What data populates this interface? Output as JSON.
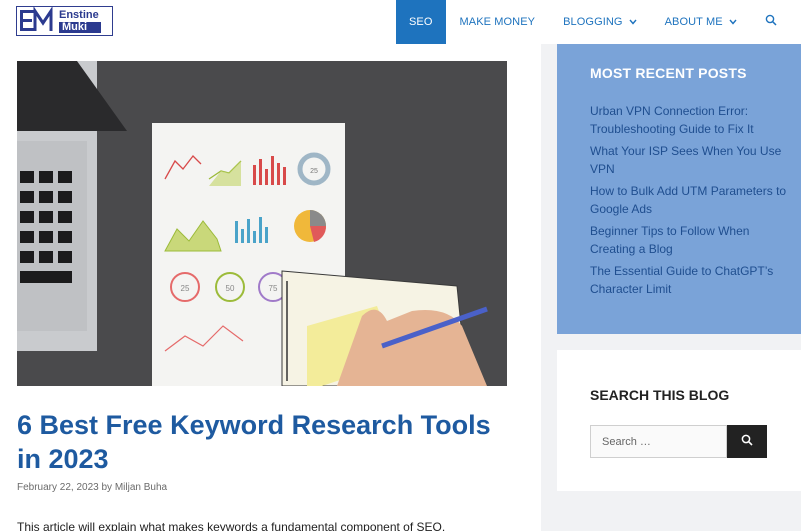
{
  "colors": {
    "accent": "#1e73be",
    "sidebar_panel": "#7aa3d8",
    "title": "#1e5aa0"
  },
  "logo": {
    "line1": "Enstine",
    "line2": "Muki"
  },
  "nav": {
    "items": [
      {
        "label": "SEO",
        "active": true
      },
      {
        "label": "MAKE MONEY"
      },
      {
        "label": "BLOGGING",
        "dropdown": true
      },
      {
        "label": "ABOUT ME",
        "dropdown": true
      }
    ],
    "search_icon": "search-icon"
  },
  "post": {
    "title": "6 Best Free Keyword Research Tools in 2023",
    "date": "February 22, 2023",
    "by": "by",
    "author": "Miljan Buha",
    "excerpt": "This article will explain what makes keywords a fundamental component of SEO."
  },
  "sidebar": {
    "recent_title": "MOST RECENT POSTS",
    "recent_posts": [
      "Urban VPN Connection Error: Troubleshooting Guide to Fix It",
      "What Your ISP Sees When You Use VPN",
      "How to Bulk Add UTM Parameters to Google Ads",
      "Beginner Tips to Follow When Creating a Blog",
      "The Essential Guide to ChatGPT’s Character Limit"
    ],
    "search_title": "SEARCH THIS BLOG",
    "search_placeholder": "Search …"
  },
  "hero_chart_labels": {
    "c1": "25",
    "c2": "50",
    "c3": "75",
    "c4": "25"
  }
}
